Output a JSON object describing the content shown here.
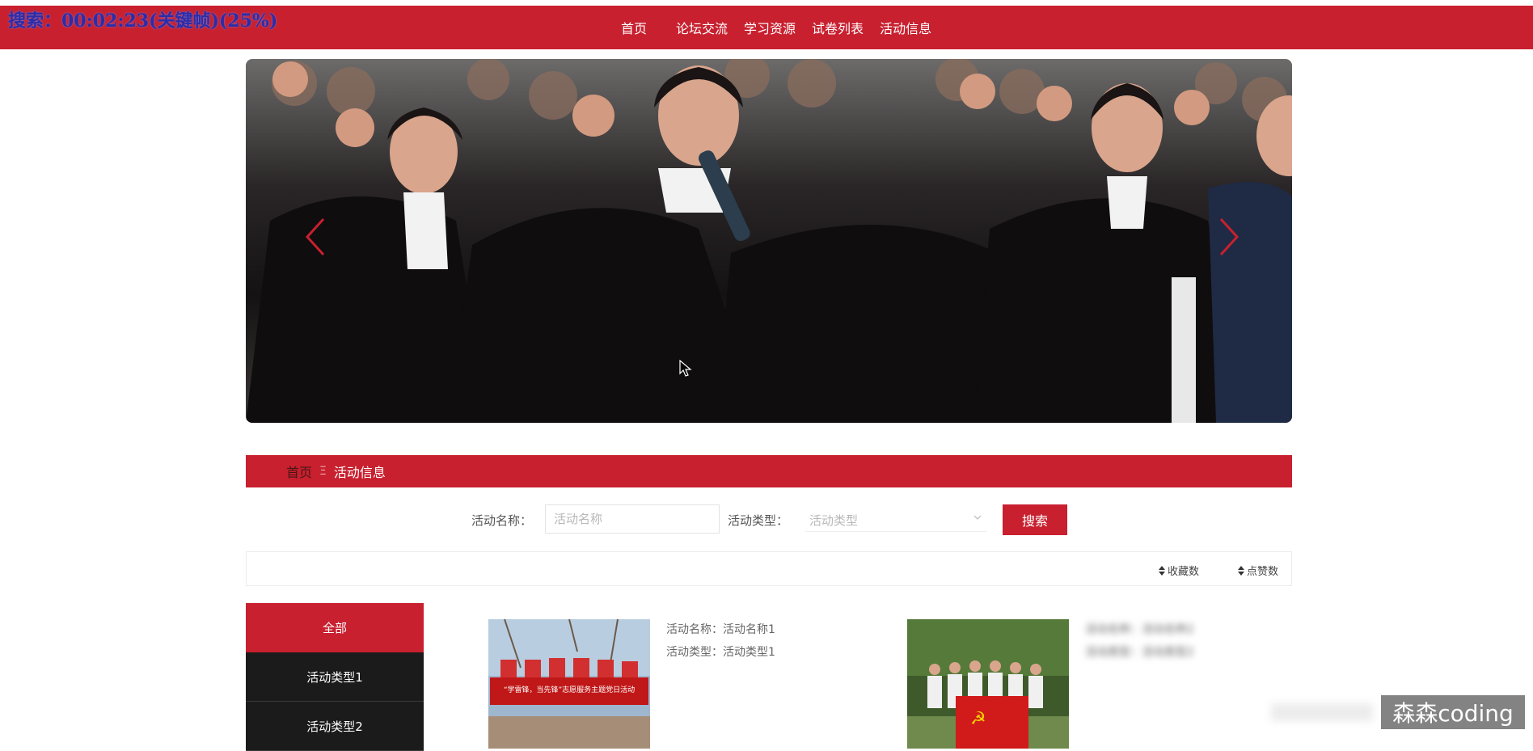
{
  "overlay": {
    "recording_text": "搜索：00:02:23(关键帧)(25%)"
  },
  "nav": {
    "items": [
      {
        "label": "首页"
      },
      {
        "label": "论坛交流"
      },
      {
        "label": "学习资源"
      },
      {
        "label": "试卷列表"
      },
      {
        "label": "活动信息"
      }
    ]
  },
  "banner": {
    "prev_icon": "chevron-left-icon",
    "next_icon": "chevron-right-icon"
  },
  "breadcrumb": {
    "home": "首页",
    "separator": "Ξ",
    "current": "活动信息"
  },
  "search": {
    "name_label": "活动名称：",
    "name_placeholder": "活动名称",
    "name_value": "",
    "type_label": "活动类型：",
    "type_placeholder": "活动类型",
    "button": "搜索"
  },
  "sort": {
    "favorites": "收藏数",
    "likes": "点赞数"
  },
  "categories": [
    {
      "label": "全部",
      "active": true
    },
    {
      "label": "活动类型1",
      "active": false
    },
    {
      "label": "活动类型2",
      "active": false
    }
  ],
  "cards": [
    {
      "name_line": "活动名称：活动名称1",
      "type_line": "活动类型：活动类型1"
    },
    {
      "name_line": "活动名称：活动名称2",
      "type_line": "活动类型：活动类型2"
    }
  ],
  "card_image_banners": {
    "card1_slogan": "“学雷锋，当先锋”志愿服务主题党日活动"
  },
  "watermark": {
    "text": "森森coding"
  },
  "colors": {
    "accent": "#c8202f",
    "sidebar_dark": "#1b1b1b",
    "overlay_text": "#2c2ca8"
  }
}
